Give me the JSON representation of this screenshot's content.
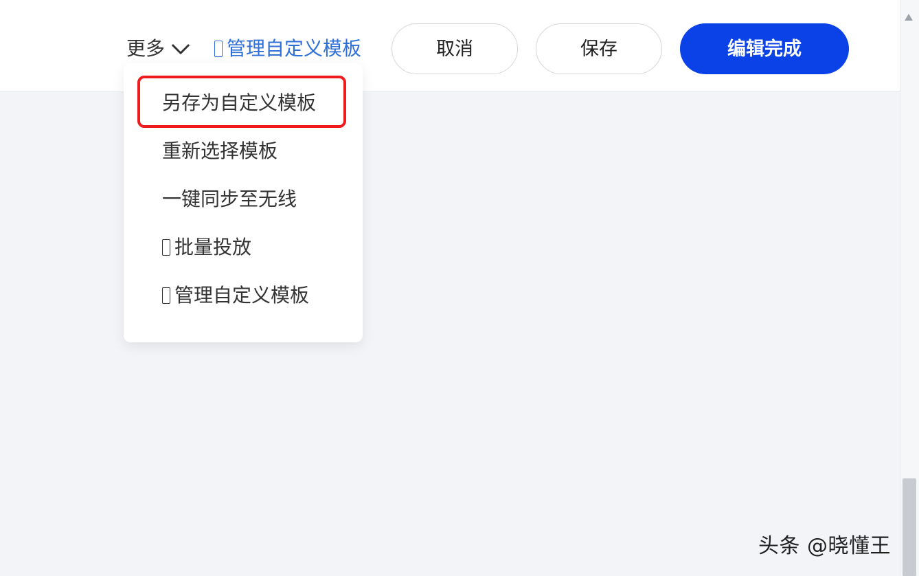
{
  "toolbar": {
    "more_label": "更多",
    "manage_templates_label": "管理自定义模板",
    "cancel_label": "取消",
    "save_label": "保存",
    "done_label": "编辑完成"
  },
  "dropdown": {
    "items": [
      {
        "label": "另存为自定义模板",
        "highlighted": true
      },
      {
        "label": "重新选择模板"
      },
      {
        "label": "一键同步至无线"
      },
      {
        "label": "批量投放",
        "leading_glyph": "placeholder-box"
      },
      {
        "label": "管理自定义模板",
        "leading_glyph": "placeholder-box"
      }
    ]
  },
  "watermark": {
    "text": "头条 @晓懂王"
  },
  "colors": {
    "primary_button": "#0a42e8",
    "link": "#2f6fd8",
    "highlight": "#ee1c1c",
    "page_background": "#f2f4f8"
  },
  "icons": {
    "more_toggle": "chevron-down-icon",
    "scroll_up": "scroll-up-arrow-icon"
  }
}
